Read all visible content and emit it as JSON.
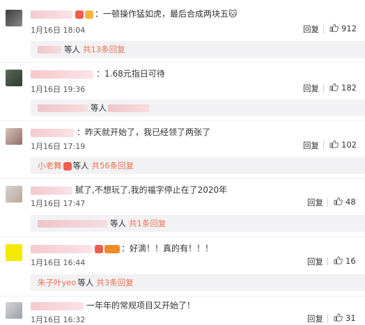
{
  "comments": [
    {
      "text": "：一顿操作猛如虎，最后合成两块五",
      "date": "1月16日 18:04",
      "reply": "回复",
      "likes": "912",
      "sub": {
        "name": "",
        "etc": "等人",
        "count": "共13条回复"
      }
    },
    {
      "text": "：1.68元指日可待",
      "date": "1月16日 19:36",
      "reply": "回复",
      "likes": "182",
      "sub": {
        "name": "",
        "etc": "等人",
        "count": ""
      }
    },
    {
      "text": "：昨天就开始了，我已经领了两张了",
      "date": "1月16日 17:19",
      "reply": "回复",
      "likes": "102",
      "sub": {
        "name": "小老舞",
        "etc": "等人",
        "count": "共56条回复"
      }
    },
    {
      "text": "腻了,不想玩了,我的福字停止在了2020年",
      "date": "1月16日 17:47",
      "reply": "回复",
      "likes": "48",
      "sub": {
        "name": "",
        "etc": "等人",
        "count": "共1条回复"
      }
    },
    {
      "text": "：好滴！！真的有！！！",
      "date": "1月16日 16:44",
      "reply": "回复",
      "likes": "16",
      "sub": {
        "name": "朱子叶yeo",
        "etc": "等人",
        "count": "共3条回复"
      }
    },
    {
      "text": "一年年的常规项目又开始了！",
      "date": "1月16日 16:32",
      "reply": "回复",
      "likes": "31"
    }
  ],
  "icons": {
    "like": "thumbs-up-icon"
  },
  "colors": {
    "accent": "#eb7350",
    "reply_box": "#f2f2f5"
  }
}
